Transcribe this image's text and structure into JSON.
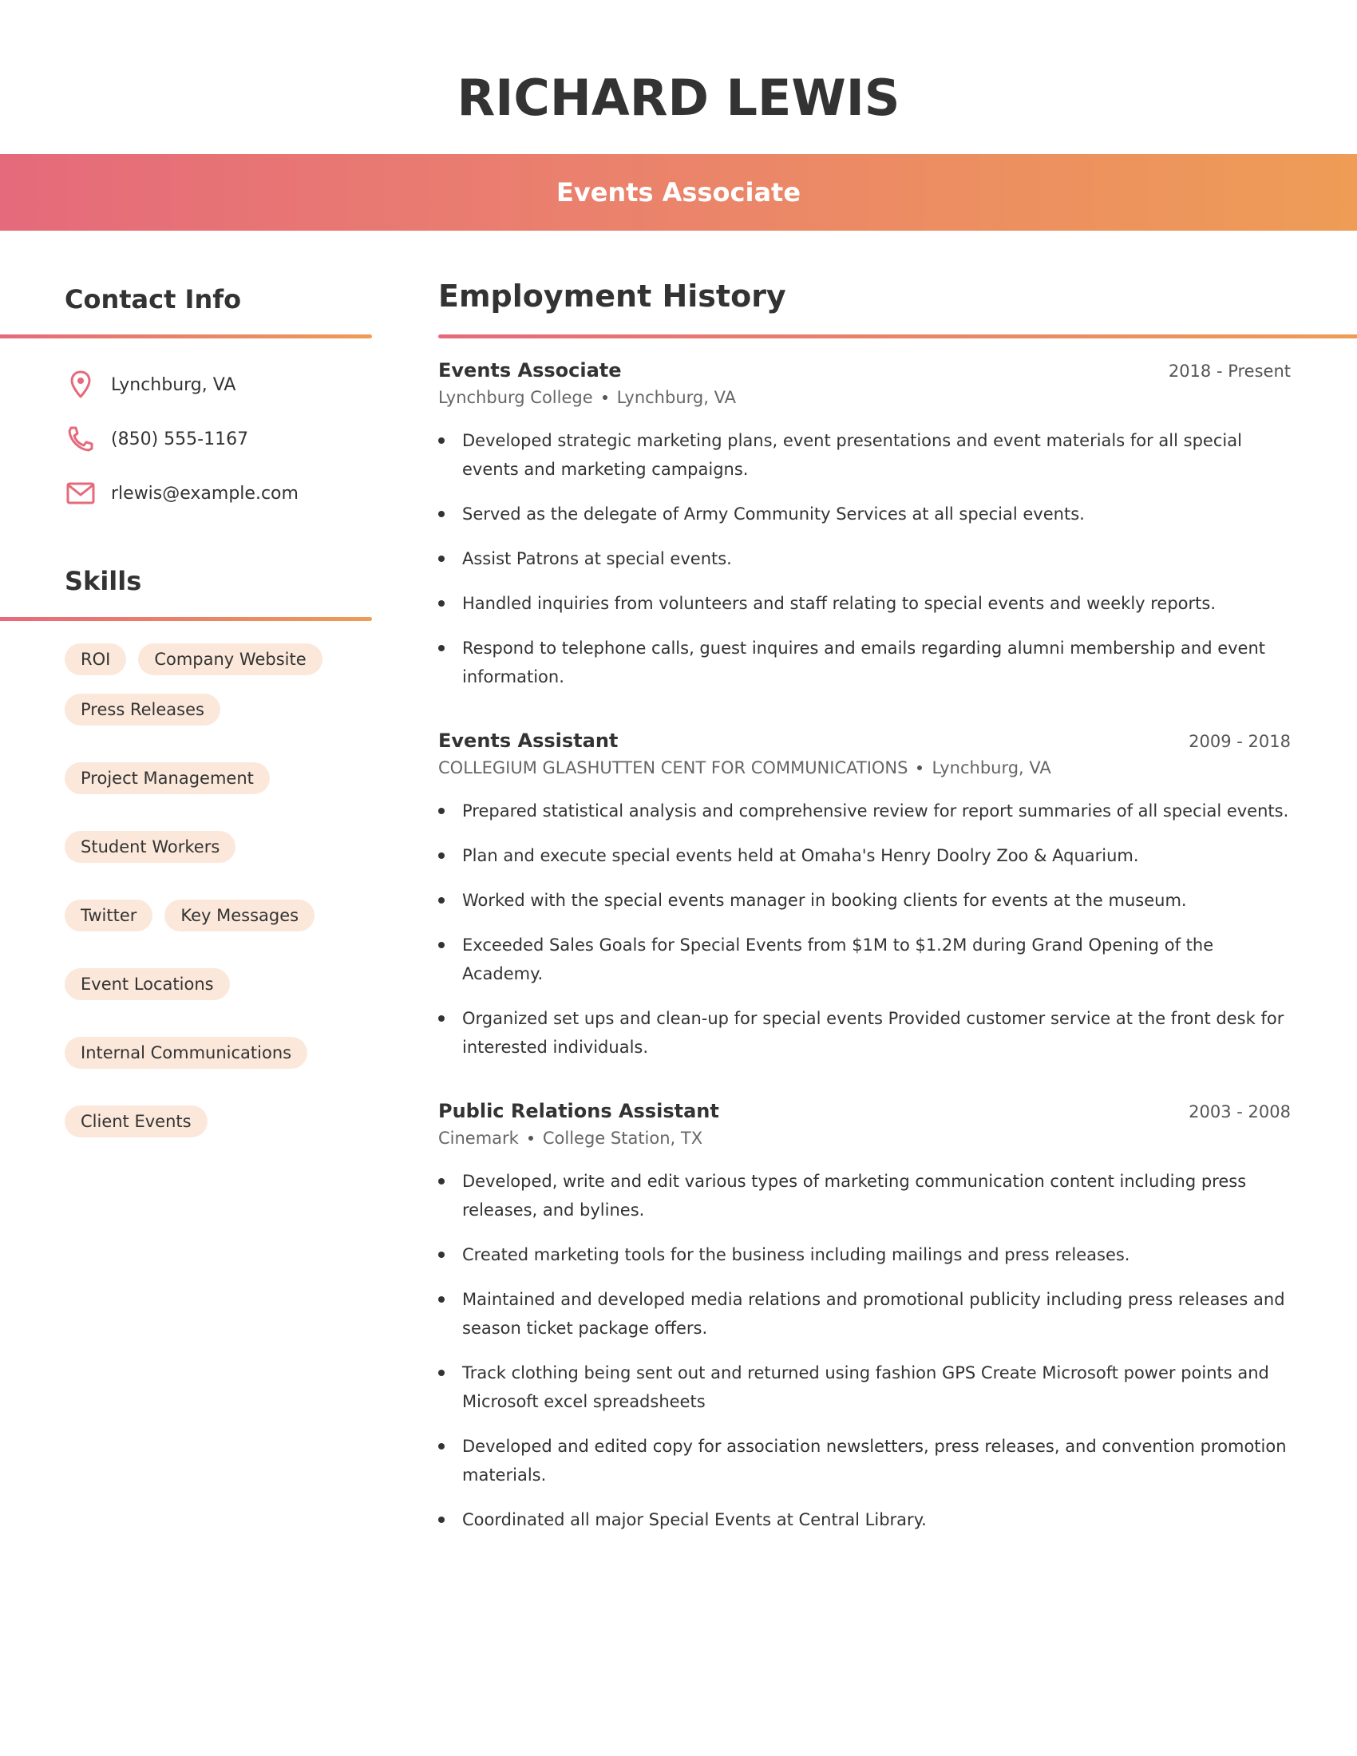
{
  "header": {
    "name": "RICHARD LEWIS",
    "job_title": "Events Associate",
    "gradient": [
      "#E56A7B",
      "#EE9C56"
    ]
  },
  "contact": {
    "title": "Contact Info",
    "items": [
      {
        "icon": "location-pin-icon",
        "text": "Lynchburg, VA"
      },
      {
        "icon": "phone-icon",
        "text": "(850) 555-1167"
      },
      {
        "icon": "mail-icon",
        "text": "rlewis@example.com"
      }
    ],
    "icon_color": "#E56A7B"
  },
  "skills": {
    "title": "Skills",
    "chip_color": "#FBE8DA",
    "items": [
      "ROI",
      "Company Website",
      "Press Releases",
      "Project Management",
      "Student Workers",
      "Twitter",
      "Key Messages",
      "Event Locations",
      "Internal Communications",
      "Client Events"
    ]
  },
  "employment": {
    "title": "Employment History",
    "jobs": [
      {
        "title": "Events Associate",
        "dates": "2018 - Present",
        "company": "Lynchburg College",
        "location": "Lynchburg, VA",
        "bullets": [
          "Developed strategic marketing plans, event presentations and event materials for all special events and marketing campaigns.",
          "Served as the delegate of Army Community Services at all special events.",
          "Assist Patrons at special events.",
          "Handled inquiries from volunteers and staff relating to special events and weekly reports.",
          "Respond to telephone calls, guest inquires and emails regarding alumni membership and event information."
        ]
      },
      {
        "title": "Events Assistant",
        "dates": "2009 - 2018",
        "company": "COLLEGIUM GLASHUTTEN CENT FOR COMMUNICATIONS",
        "location": "Lynchburg, VA",
        "bullets": [
          "Prepared statistical analysis and comprehensive review for report summaries of all special events.",
          "Plan and execute special events held at Omaha's Henry Doolry Zoo & Aquarium.",
          "Worked with the special events manager in booking clients for events at the museum.",
          "Exceeded Sales Goals for Special Events from $1M to $1.2M during Grand Opening of the Academy.",
          "Organized set ups and clean-up for special events Provided customer service at the front desk for interested individuals."
        ]
      },
      {
        "title": "Public Relations Assistant",
        "dates": "2003 - 2008",
        "company": "Cinemark",
        "location": "College Station, TX",
        "bullets": [
          "Developed, write and edit various types of marketing communication content including press releases, and bylines.",
          "Created marketing tools for the business including mailings and press releases.",
          "Maintained and developed media relations and promotional publicity including press releases and season ticket package offers.",
          "Track clothing being sent out and returned using fashion GPS Create Microsoft power points and Microsoft excel spreadsheets",
          "Developed and edited copy for association newsletters, press releases, and convention promotion materials.",
          "Coordinated all major Special Events at Central Library."
        ]
      }
    ]
  }
}
